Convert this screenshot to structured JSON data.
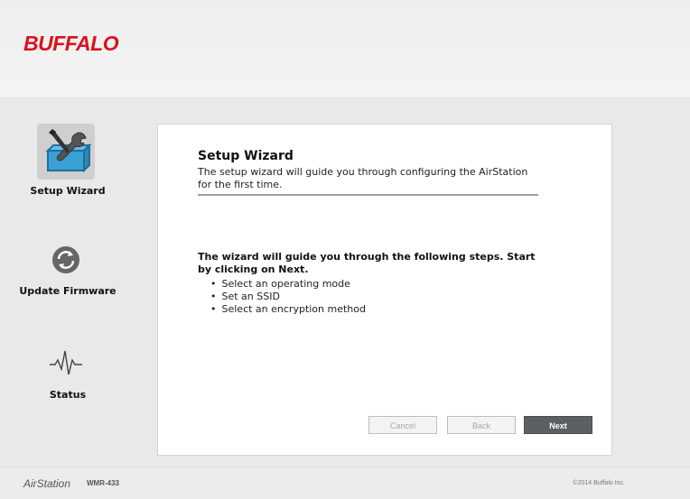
{
  "header": {
    "logo_text": "BUFFALO"
  },
  "sidebar": {
    "items": [
      {
        "label": "Setup Wizard",
        "icon": "setup-wizard-icon",
        "active": true
      },
      {
        "label": "Update Firmware",
        "icon": "update-firmware-icon",
        "active": false
      },
      {
        "label": "Status",
        "icon": "status-icon",
        "active": false
      }
    ]
  },
  "panel": {
    "title": "Setup Wizard",
    "description": "The setup wizard will guide you through configuring the AirStation for the first time.",
    "intro": "The wizard will guide you through the following steps. Start by clicking on Next.",
    "steps": [
      "Select an operating mode",
      "Set an SSID",
      "Select an encryption method"
    ],
    "buttons": {
      "cancel": "Cancel",
      "back": "Back",
      "next": "Next"
    }
  },
  "footer": {
    "brand": "AirStation",
    "model": "WMR-433",
    "copyright": "©2014 Buffalo Inc."
  },
  "colors": {
    "brand_red": "#d8131d",
    "next_button": "#5d6063",
    "background": "#e9e9e9"
  }
}
